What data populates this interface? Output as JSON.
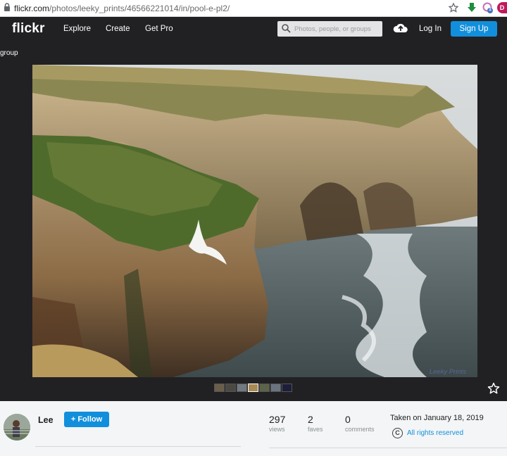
{
  "browser": {
    "url_host": "flickr.com",
    "url_path": "/photos/leeky_prints/46566221014/in/pool-e-pl2/",
    "badge_count": "1",
    "profile_initial": "D"
  },
  "header": {
    "logo": "flickr",
    "nav": [
      "Explore",
      "Create",
      "Get Pro"
    ],
    "search_placeholder": "Photos, people, or groups",
    "login_label": "Log In",
    "signup_label": "Sign Up",
    "accent_color": "#128fdc"
  },
  "stage": {
    "breadcrumb": "group",
    "watermark": "Leeky Prints",
    "filmstrip_count": 7,
    "selected_thumb_index": 3
  },
  "owner": {
    "name": "Lee",
    "follow_label": "+ Follow"
  },
  "stats": [
    {
      "value": "297",
      "label": "views"
    },
    {
      "value": "2",
      "label": "faves"
    },
    {
      "value": "0",
      "label": "comments"
    }
  ],
  "meta": {
    "taken": "Taken on January 18, 2019",
    "license_icon": "C",
    "rights": "All rights reserved"
  }
}
